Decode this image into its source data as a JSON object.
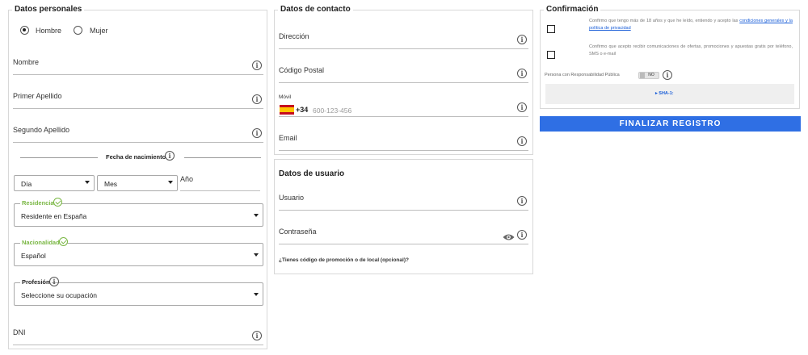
{
  "personal": {
    "title": "Datos personales",
    "gender_male": "Hombre",
    "gender_female": "Mujer",
    "selected_gender": "Hombre",
    "nombre_label": "Nombre",
    "apellido1_label": "Primer Apellido",
    "apellido2_label": "Segundo Apellido",
    "birth_label": "Fecha de nacimiento",
    "day_value": "Día",
    "month_value": "Mes",
    "year_placeholder": "Año",
    "residencia_label": "Residencia",
    "residencia_value": "Residente en España",
    "nacionalidad_label": "Nacionalidad",
    "nacionalidad_value": "Español",
    "profesion_label": "Profesión",
    "profesion_value": "Seleccione su ocupación",
    "dni_label": "DNI"
  },
  "contact": {
    "title": "Datos de contacto",
    "direccion_label": "Dirección",
    "cp_label": "Código Postal",
    "movil_label": "Móvil",
    "prefix": "+34",
    "phone_placeholder": "600-123-456",
    "email_label": "Email"
  },
  "user": {
    "title": "Datos de usuario",
    "usuario_label": "Usuario",
    "password_label": "Contraseña",
    "promo_link": "¿Tienes código de promoción o de local (opcional)?"
  },
  "confirm": {
    "title": "Confirmación",
    "consent1_text": "Confirmo que tengo más de 18 años y que he leído, entiendo y acepto las ",
    "consent1_link": "condiciones generales y la política de privacidad",
    "consent2_text": "Confirmo que acepto recibir comunicaciones de ofertas, promociones y apuestas gratis por teléfono, SMS o e-mail",
    "pep_label": "Persona con Responsabilidad Pública",
    "pep_toggle": "NO",
    "sha_label": "▸ SHA-1:",
    "submit_label": "FINALIZAR REGISTRO"
  },
  "colors": {
    "accent": "#2f6fe4",
    "valid": "#7ab744",
    "link": "#1a5ed8"
  },
  "icons": [
    "info-icon",
    "check-circle-icon",
    "eye-icon",
    "spain-flag-icon",
    "chevron-down-icon"
  ]
}
